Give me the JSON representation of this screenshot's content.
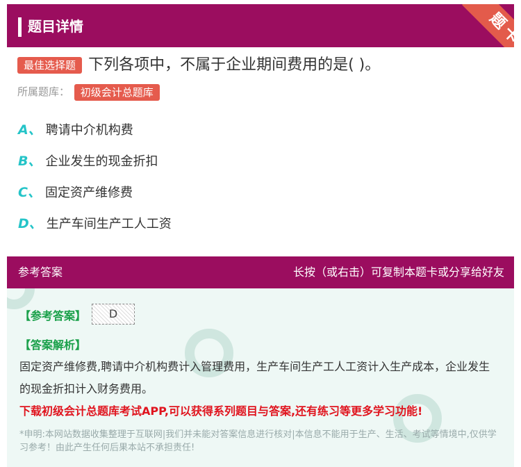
{
  "header": {
    "title": "题目详情",
    "ribbon": "题卡"
  },
  "question": {
    "tag": "最佳选择题",
    "text": "下列各项中，不属于企业期间费用的是( )。",
    "bank_label": "所属题库：",
    "bank_name": "初级会计总题库"
  },
  "options": [
    {
      "letter": "A、",
      "text": "聘请中介机构费"
    },
    {
      "letter": "B、",
      "text": "企业发生的现金折扣"
    },
    {
      "letter": "C、",
      "text": "固定资产维修费"
    },
    {
      "letter": "D、",
      "text": "生产车间生产工人工资"
    }
  ],
  "answer": {
    "header_left": "参考答案",
    "header_right": "长按（或右击）可复制本题卡或分享给好友",
    "ref_label": "【参考答案】",
    "ref_value": "D",
    "analysis_label": "【答案解析】",
    "analysis": "固定资产维修费,聘请中介机构费计入管理费用，生产车间生产工人工资计入生产成本，企业发生的现金折扣计入财务费用。",
    "promo": "下载初级会计总题库考试APP,可以获得系列题目与答案,还有练习等更多学习功能!",
    "disclaimer": "*申明:本网站数据收集整理于互联网|我们并未能对答案信息进行核对|本信息不能用于生产、生活、考试等情境中,仅供学习参考！由此产生任何后果本站不承担责任!"
  },
  "colors": {
    "accent": "#9b0d5f",
    "tag": "#e55b4d",
    "option_letter": "#25c4c8",
    "label_green": "#1aa04a",
    "promo_red": "#e0141e"
  }
}
